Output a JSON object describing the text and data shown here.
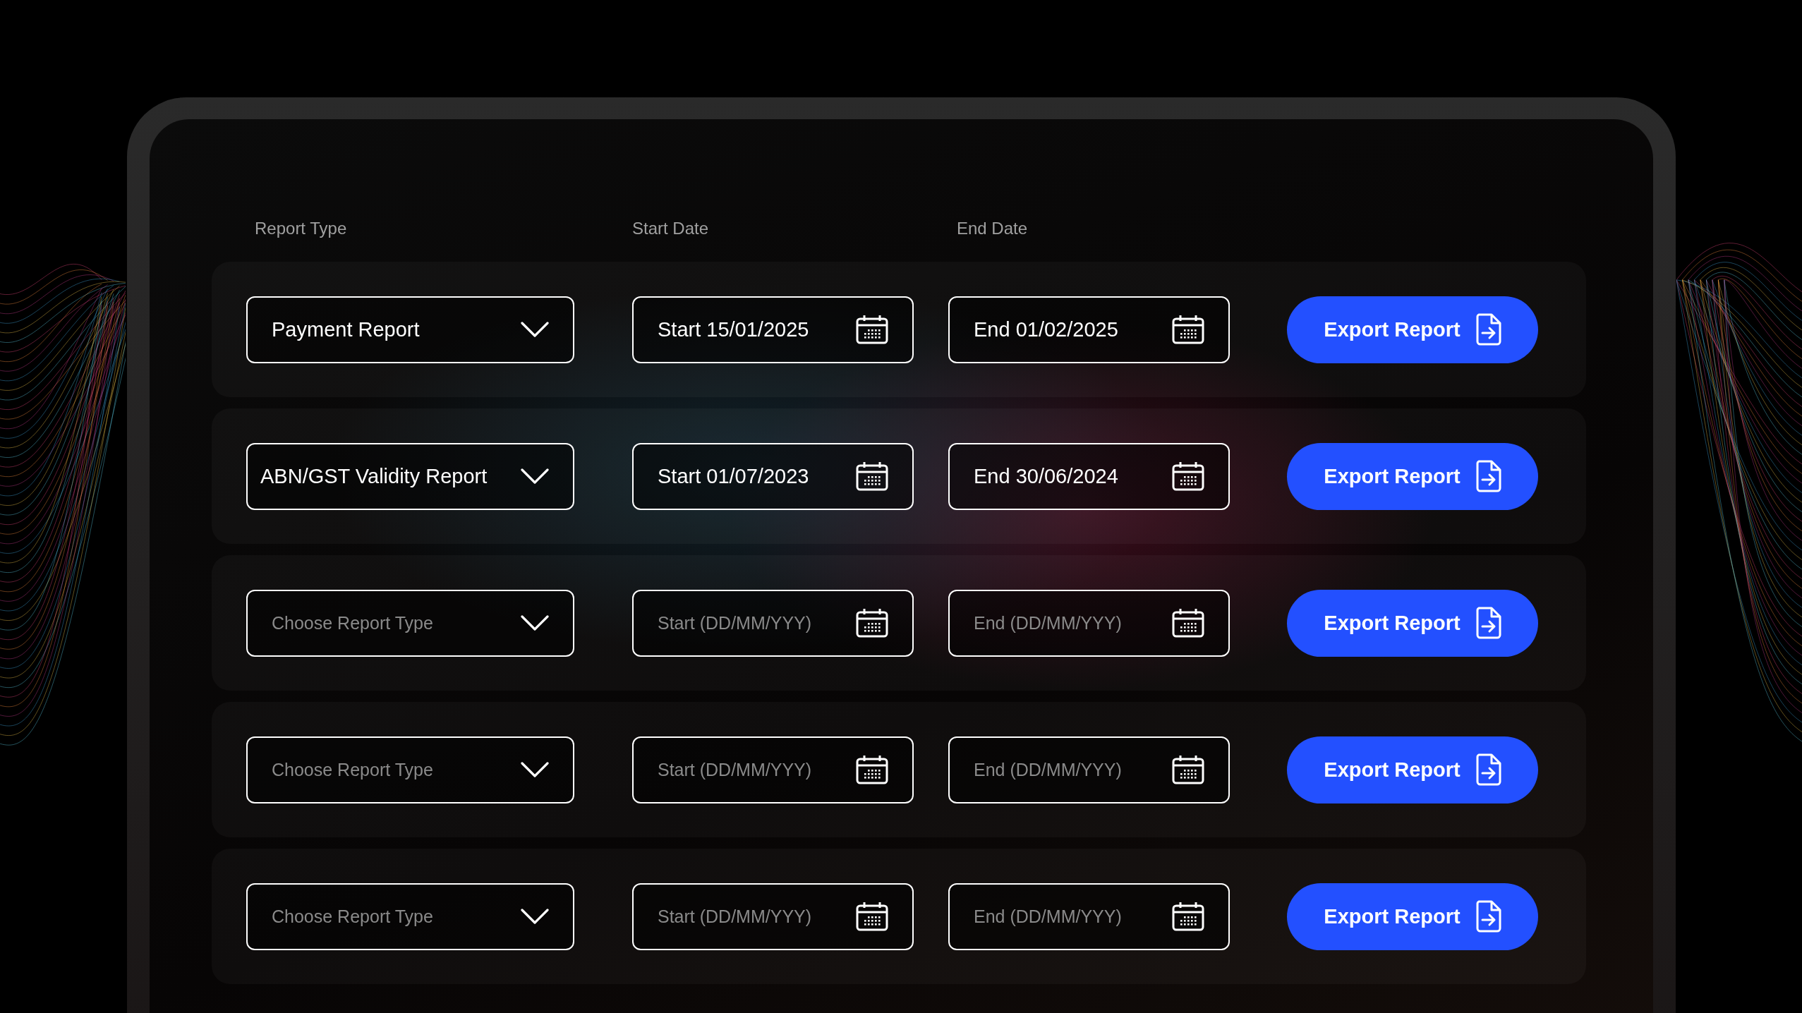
{
  "headers": [
    "Report Type",
    "Start Date",
    "End Date"
  ],
  "rows": [
    {
      "report_type": {
        "value": "Payment Report"
      },
      "start": {
        "value": "Start 15/01/2025"
      },
      "end": {
        "value": "End 01/02/2025"
      },
      "button": "Export Report"
    },
    {
      "report_type": {
        "value": "ABN/GST Validity Report"
      },
      "start": {
        "value": "Start 01/07/2023"
      },
      "end": {
        "value": "End 30/06/2024"
      },
      "button": "Export Report"
    },
    {
      "report_type": {
        "placeholder": "Choose Report Type"
      },
      "start": {
        "placeholder": "Start (DD/MM/YYY)"
      },
      "end": {
        "placeholder": "End (DD/MM/YYY)"
      },
      "button": "Export Report"
    },
    {
      "report_type": {
        "placeholder": "Choose Report Type"
      },
      "start": {
        "placeholder": "Start (DD/MM/YYY)"
      },
      "end": {
        "placeholder": "End (DD/MM/YYY)"
      },
      "button": "Export Report"
    },
    {
      "report_type": {
        "placeholder": "Choose Report Type"
      },
      "start": {
        "placeholder": "Start (DD/MM/YYY)"
      },
      "end": {
        "placeholder": "End (DD/MM/YYY)"
      },
      "button": "Export Report"
    }
  ]
}
